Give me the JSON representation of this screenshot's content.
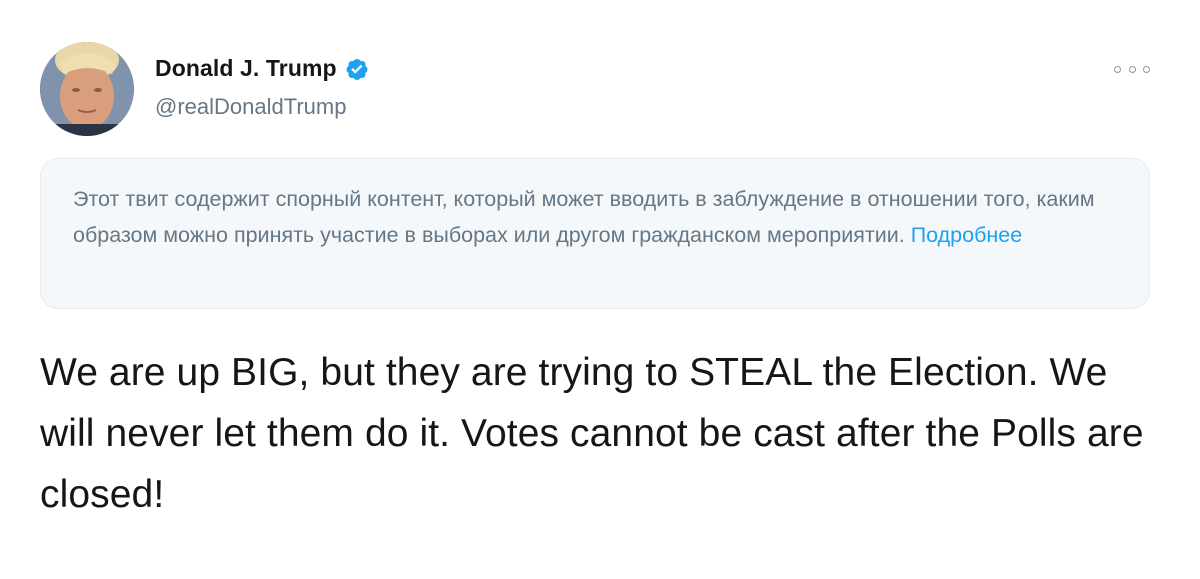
{
  "author": {
    "name": "Donald J. Trump",
    "handle": "@realDonaldTrump",
    "verified": true
  },
  "notice": {
    "text": "Этот твит содержит спорный контент, который может вводить в заблуждение в отношении того, каким образом можно принять участие в выборах или другом гражданском мероприятии.",
    "link_label": "Подробнее"
  },
  "tweet": {
    "text": "We are up BIG, but they are trying to STEAL the Election. We will never let them do it. Votes cannot be cast after the Polls are closed!"
  },
  "icons": {
    "verified": "verified-badge-icon",
    "more": "more-options-icon"
  },
  "colors": {
    "accent": "#1da1f2",
    "text": "#14171a",
    "secondary": "#657786",
    "notice_bg": "#f5f8fa"
  }
}
